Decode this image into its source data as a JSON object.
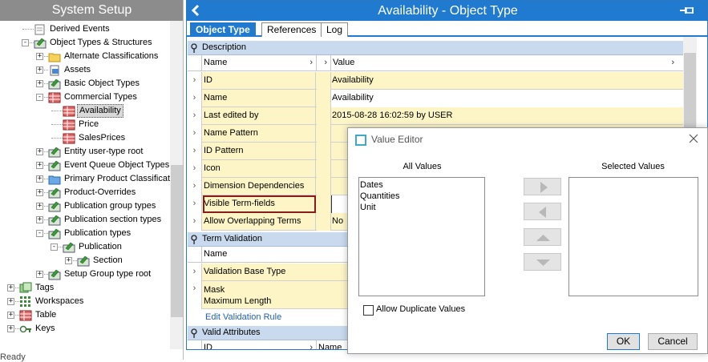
{
  "left_pane": {
    "title": "System Setup",
    "status": "Ready",
    "tree": [
      {
        "label": "Derived Events",
        "indent": 1,
        "expander": "",
        "icon": "derived-events-icon"
      },
      {
        "label": "Object Types & Structures",
        "indent": 1,
        "expander": "-",
        "icon": "object-type-icon"
      },
      {
        "label": "Alternate Classifications",
        "indent": 2,
        "expander": "+",
        "icon": "folder-icon"
      },
      {
        "label": "Assets",
        "indent": 2,
        "expander": "+",
        "icon": "asset-icon"
      },
      {
        "label": "Basic Object Types",
        "indent": 2,
        "expander": "+",
        "icon": "object-type-icon"
      },
      {
        "label": "Commercial Types",
        "indent": 2,
        "expander": "-",
        "icon": "table-icon"
      },
      {
        "label": "Availability",
        "indent": 3,
        "expander": "",
        "icon": "table-icon",
        "selected": true
      },
      {
        "label": "Price",
        "indent": 3,
        "expander": "",
        "icon": "table-icon"
      },
      {
        "label": "SalesPrices",
        "indent": 3,
        "expander": "",
        "icon": "table-icon"
      },
      {
        "label": "Entity user-type root",
        "indent": 2,
        "expander": "+",
        "icon": "object-type-icon"
      },
      {
        "label": "Event Queue Object Types",
        "indent": 2,
        "expander": "+",
        "icon": "object-type-icon"
      },
      {
        "label": "Primary Product Classification",
        "indent": 2,
        "expander": "+",
        "icon": "blue-folder-icon"
      },
      {
        "label": "Product-Overrides",
        "indent": 2,
        "expander": "+",
        "icon": "object-type-icon"
      },
      {
        "label": "Publication group types",
        "indent": 2,
        "expander": "+",
        "icon": "object-type-icon"
      },
      {
        "label": "Publication section types",
        "indent": 2,
        "expander": "+",
        "icon": "object-type-icon"
      },
      {
        "label": "Publication types",
        "indent": 2,
        "expander": "-",
        "icon": "object-type-icon"
      },
      {
        "label": "Publication",
        "indent": 3,
        "expander": "-",
        "icon": "object-type-icon"
      },
      {
        "label": "Section",
        "indent": 4,
        "expander": "+",
        "icon": "object-type-icon"
      },
      {
        "label": "Setup Group type root",
        "indent": 2,
        "expander": "+",
        "icon": "object-type-icon"
      },
      {
        "label": "Tags",
        "indent": 0,
        "expander": "+",
        "icon": "tags-icon"
      },
      {
        "label": "Workspaces",
        "indent": 0,
        "expander": "+",
        "icon": "workspaces-icon"
      },
      {
        "label": "Table",
        "indent": 0,
        "expander": "+",
        "icon": "table-icon"
      },
      {
        "label": "Keys",
        "indent": 0,
        "expander": "+",
        "icon": "keys-icon"
      }
    ]
  },
  "main_pane": {
    "back_icon": "back-arrow-icon",
    "title": "Availability - Object Type",
    "pin_icon": "pin-icon",
    "tabs": [
      {
        "label": "Object Type",
        "active": true
      },
      {
        "label": "References",
        "active": false
      },
      {
        "label": "Log",
        "active": false
      }
    ],
    "description_section": {
      "title": "Description",
      "col_name": "Name",
      "col_value": "Value",
      "rows": [
        {
          "name": "ID",
          "value": ""
        },
        {
          "name": "Name",
          "value": ""
        },
        {
          "name": "Last edited by",
          "value": ""
        },
        {
          "name": "Name Pattern",
          "value": ""
        },
        {
          "name": "ID Pattern",
          "value": ""
        },
        {
          "name": "Icon",
          "value": ""
        },
        {
          "name": "Dimension Dependencies",
          "value": ""
        },
        {
          "name": "Visible Term-fields",
          "value": ""
        },
        {
          "name": "Allow Overlapping Terms",
          "value": ""
        }
      ],
      "values": [
        "Availability",
        "Availability",
        "2015-08-28 16:02:59 by USER",
        "",
        "",
        "",
        "",
        "",
        "No"
      ]
    },
    "term_validation_section": {
      "title": "Term Validation",
      "col_name": "Name",
      "rows": [
        "Validation Base Type",
        "Mask",
        "Maximum Length"
      ],
      "link": "Edit Validation Rule"
    },
    "valid_attributes_section": {
      "title": "Valid Attributes",
      "col_id": "ID",
      "col_name": "Name"
    }
  },
  "dialog": {
    "title": "Value Editor",
    "all_values_label": "All Values",
    "selected_values_label": "Selected Values",
    "all_values": [
      "Dates",
      "Quantities",
      "Unit"
    ],
    "selected_values": [],
    "allow_duplicates_label": "Allow Duplicate Values",
    "allow_duplicates_checked": false,
    "ok_label": "OK",
    "cancel_label": "Cancel"
  },
  "colors": {
    "accent": "#1f7ad0",
    "row_bg": "#fdf5c6",
    "section_bg": "#c9d9ee",
    "highlight_border": "#8b1a1a"
  }
}
